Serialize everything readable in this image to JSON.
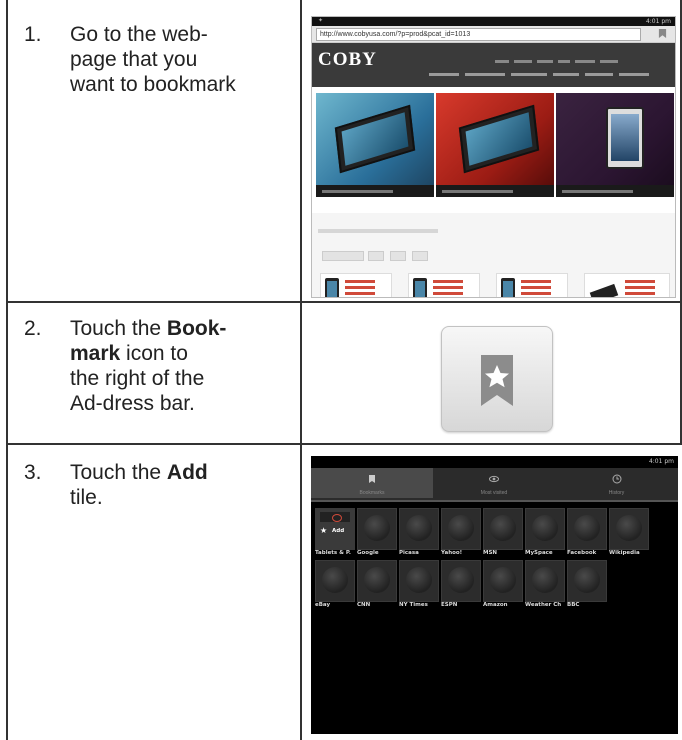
{
  "steps": [
    {
      "num": "1.",
      "text_lines": [
        "Go to the web-",
        "page that you",
        "want to bookmark"
      ]
    },
    {
      "num": "2.",
      "pre": "Touch the ",
      "bold1": "Book-",
      "bold2": "mark",
      "post1": " icon to",
      "line3": "the right of the",
      "line4": "Ad-dress bar."
    },
    {
      "num": "3.",
      "pre": "Touch the ",
      "bold": "Add",
      "post": "tile."
    }
  ],
  "browser": {
    "url": "http://www.cobyusa.com/?p=prod&pcat_id=1013",
    "logo": "COBY",
    "time": "4:01 pm"
  },
  "bookmarks_screen": {
    "time": "4:01 pm",
    "tabs": [
      {
        "label": "Bookmarks",
        "icon": "bookmark-icon"
      },
      {
        "label": "Most visited",
        "icon": "eye-icon"
      },
      {
        "label": "History",
        "icon": "clock-icon"
      }
    ],
    "add_label": "Add",
    "row1": [
      "Tablets & P.",
      "Google",
      "Picasa",
      "Yahoo!",
      "MSN",
      "MySpace",
      "Facebook",
      "Wikipedia"
    ],
    "row2": [
      "eBay",
      "CNN",
      "NY Times",
      "ESPN",
      "Amazon",
      "Weather Ch",
      "BBC"
    ]
  },
  "colors": {
    "accent": "#d04a3a",
    "border": "#333333"
  }
}
